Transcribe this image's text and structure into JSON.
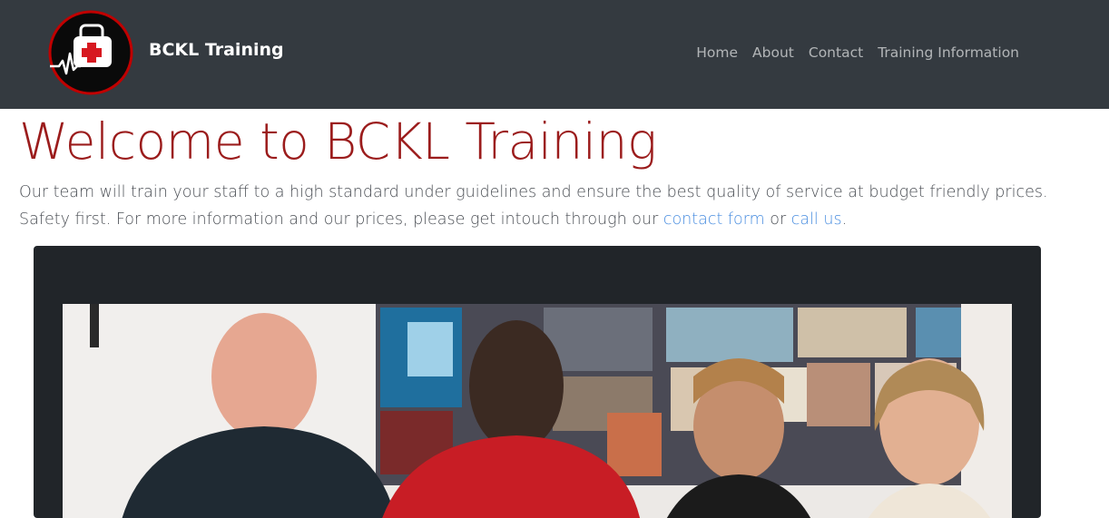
{
  "brand": {
    "name": "BCKL Training",
    "logo_icon": "first-aid-kit-heartbeat-icon",
    "colors": {
      "ring": "#c00000",
      "cross": "#d71920"
    }
  },
  "nav": {
    "items": [
      {
        "label": "Home"
      },
      {
        "label": "About"
      },
      {
        "label": "Contact"
      },
      {
        "label": "Training Information"
      }
    ]
  },
  "hero": {
    "title": "Welcome to BCKL Training",
    "intro_before": "Our team will train your staff to a high standard under guidelines and ensure the best quality of service at budget friendly prices. Safety first. For more information and our prices, please get intouch through our ",
    "contact_link": "contact form",
    "intro_middle": " or ",
    "call_link": "call us",
    "intro_after": "."
  },
  "photo": {
    "subject": "team-photo"
  },
  "colors": {
    "navbar": "#343a40",
    "heading": "#9b1c1c",
    "link": "#4a8ee0",
    "card": "#212529"
  }
}
